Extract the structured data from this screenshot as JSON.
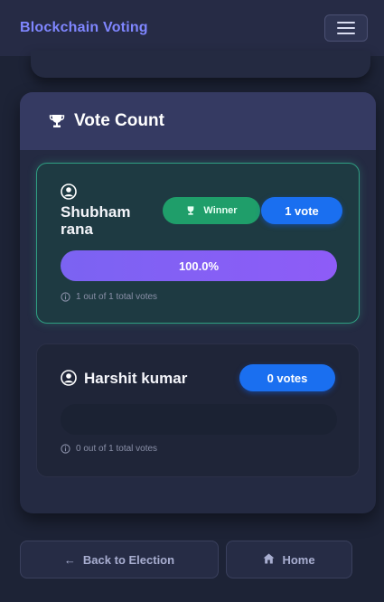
{
  "navbar": {
    "brand": "Blockchain Voting",
    "menu_icon": "hamburger-icon"
  },
  "vote_count": {
    "title": "Vote Count",
    "title_icon": "trophy-icon",
    "candidates": [
      {
        "name": "Shubham rana",
        "icon": "user-circle-icon",
        "winner_label": "Winner",
        "votes_label": "1 vote",
        "percent": 100.0,
        "percent_label": "100.0%",
        "note": "1 out of 1 total votes"
      },
      {
        "name": "Harshit kumar",
        "icon": "user-circle-icon",
        "votes_label": "0 votes",
        "percent": 0.0,
        "percent_label": "",
        "note": "0 out of 1 total votes"
      }
    ]
  },
  "actions": {
    "back_label": "Back to Election",
    "back_icon": "arrow-left-icon",
    "home_label": "Home",
    "home_icon": "home-icon"
  },
  "colors": {
    "background": "#1d2336",
    "brand": "#7f86ff",
    "winner_green": "#1f9e6a",
    "vote_blue": "#1a6ff0",
    "progress_purple": "#7b63f2"
  }
}
